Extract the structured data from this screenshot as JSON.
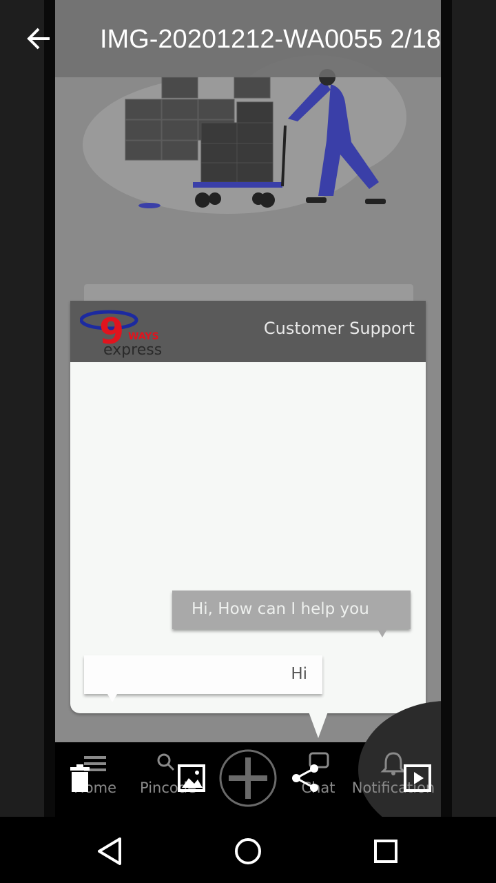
{
  "viewer": {
    "title": "IMG-20201212-WA0055",
    "counter": "2/18",
    "actions": [
      {
        "name": "delete-icon"
      },
      {
        "name": "image-icon"
      },
      {
        "name": "share-icon"
      },
      {
        "name": "slideshow-icon"
      }
    ]
  },
  "app": {
    "logo_text_top": "9",
    "logo_text_ways": "WAYS",
    "logo_text_bottom": "express",
    "header_title": "Customer Support",
    "messages": [
      {
        "from": "bot",
        "text": "Hi, How can I help you"
      },
      {
        "from": "user",
        "text": "Hi"
      }
    ],
    "nav": [
      {
        "label": "Home",
        "icon": "menu-icon"
      },
      {
        "label": "Pincode",
        "icon": "search-icon"
      },
      {
        "label": "",
        "icon": "plus-icon"
      },
      {
        "label": "Chat",
        "icon": "chat-icon"
      },
      {
        "label": "Notification",
        "icon": "bell-icon"
      }
    ]
  },
  "system_nav": [
    "back-icon",
    "home-icon",
    "recents-icon"
  ],
  "colors": {
    "logo_red": "#e0141e",
    "logo_blue": "#1c2aa0",
    "worker_blue": "#3a3fa8"
  }
}
